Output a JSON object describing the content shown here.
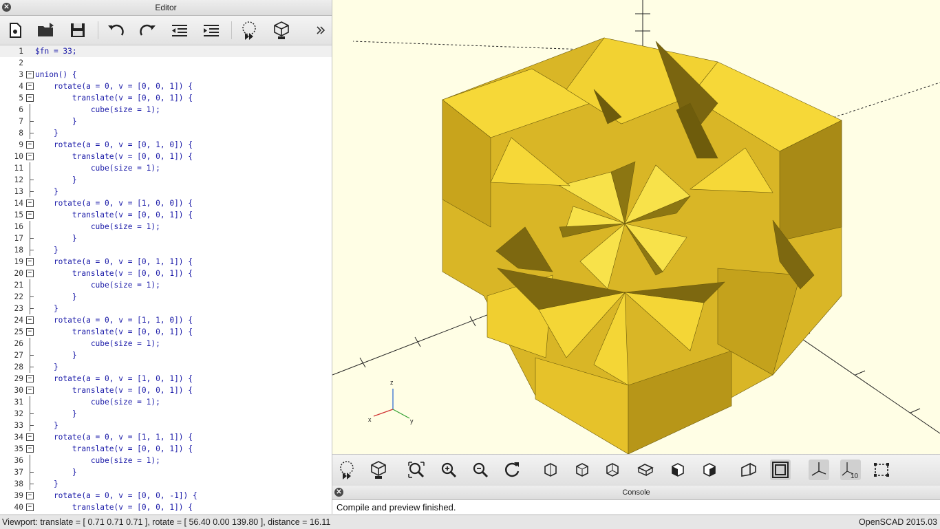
{
  "editor": {
    "title": "Editor",
    "toolbar": {
      "icons": [
        "new-file-icon",
        "open-file-icon",
        "save-icon",
        "undo-icon",
        "redo-icon",
        "unindent-icon",
        "indent-icon",
        "preview-icon",
        "render-icon",
        "more-icon"
      ]
    },
    "lines": [
      {
        "n": "1",
        "text": "$fn = 33;"
      },
      {
        "n": "2",
        "text": ""
      },
      {
        "n": "3",
        "text": "union() {"
      },
      {
        "n": "4",
        "text": "    rotate(a = 0, v = [0, 0, 1]) {"
      },
      {
        "n": "5",
        "text": "        translate(v = [0, 0, 1]) {"
      },
      {
        "n": "6",
        "text": "            cube(size = 1);"
      },
      {
        "n": "7",
        "text": "        }"
      },
      {
        "n": "8",
        "text": "    }"
      },
      {
        "n": "9",
        "text": "    rotate(a = 0, v = [0, 1, 0]) {"
      },
      {
        "n": "10",
        "text": "        translate(v = [0, 0, 1]) {"
      },
      {
        "n": "11",
        "text": "            cube(size = 1);"
      },
      {
        "n": "12",
        "text": "        }"
      },
      {
        "n": "13",
        "text": "    }"
      },
      {
        "n": "14",
        "text": "    rotate(a = 0, v = [1, 0, 0]) {"
      },
      {
        "n": "15",
        "text": "        translate(v = [0, 0, 1]) {"
      },
      {
        "n": "16",
        "text": "            cube(size = 1);"
      },
      {
        "n": "17",
        "text": "        }"
      },
      {
        "n": "18",
        "text": "    }"
      },
      {
        "n": "19",
        "text": "    rotate(a = 0, v = [0, 1, 1]) {"
      },
      {
        "n": "20",
        "text": "        translate(v = [0, 0, 1]) {"
      },
      {
        "n": "21",
        "text": "            cube(size = 1);"
      },
      {
        "n": "22",
        "text": "        }"
      },
      {
        "n": "23",
        "text": "    }"
      },
      {
        "n": "24",
        "text": "    rotate(a = 0, v = [1, 1, 0]) {"
      },
      {
        "n": "25",
        "text": "        translate(v = [0, 0, 1]) {"
      },
      {
        "n": "26",
        "text": "            cube(size = 1);"
      },
      {
        "n": "27",
        "text": "        }"
      },
      {
        "n": "28",
        "text": "    }"
      },
      {
        "n": "29",
        "text": "    rotate(a = 0, v = [1, 0, 1]) {"
      },
      {
        "n": "30",
        "text": "        translate(v = [0, 0, 1]) {"
      },
      {
        "n": "31",
        "text": "            cube(size = 1);"
      },
      {
        "n": "32",
        "text": "        }"
      },
      {
        "n": "33",
        "text": "    }"
      },
      {
        "n": "34",
        "text": "    rotate(a = 0, v = [1, 1, 1]) {"
      },
      {
        "n": "35",
        "text": "        translate(v = [0, 0, 1]) {"
      },
      {
        "n": "36",
        "text": "            cube(size = 1);"
      },
      {
        "n": "37",
        "text": "        }"
      },
      {
        "n": "38",
        "text": "    }"
      },
      {
        "n": "39",
        "text": "    rotate(a = 0, v = [0, 0, -1]) {"
      },
      {
        "n": "40",
        "text": "        translate(v = [0, 0, 1]) {"
      }
    ]
  },
  "viewport": {
    "axis_labels": {
      "z": "z",
      "x": "x",
      "y": "y"
    },
    "colors": {
      "background": "#fffee5",
      "model_light": "#f8d838",
      "model_mid": "#d8b424",
      "model_dark": "#8a7210"
    }
  },
  "view_toolbar": {
    "icons": [
      "preview-icon",
      "render-icon",
      "view-all-icon",
      "zoom-in-icon",
      "zoom-out-icon",
      "reset-view-icon",
      "view-right-icon",
      "view-top-icon",
      "view-bottom-icon",
      "view-left-icon",
      "view-front-icon",
      "view-back-icon",
      "perspective-icon",
      "orthogonal-icon",
      "show-axes-icon",
      "show-scale-icon",
      "show-edges-icon"
    ],
    "scale_label": "10"
  },
  "console": {
    "title": "Console",
    "message": "Compile and preview finished."
  },
  "status": {
    "viewport": "Viewport: translate = [ 0.71 0.71 0.71 ], rotate = [ 56.40 0.00 139.80 ], distance = 16.11",
    "version": "OpenSCAD 2015.03"
  }
}
